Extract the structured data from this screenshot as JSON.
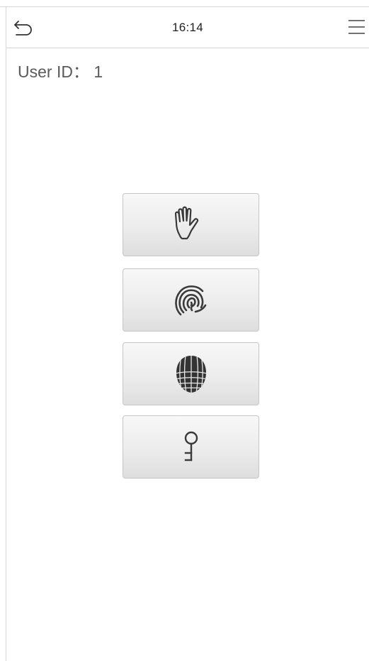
{
  "header": {
    "time": "16:14",
    "back_icon": "back-arrow-icon",
    "menu_icon": "hamburger-menu-icon"
  },
  "user": {
    "id_label": "User ID： 1"
  },
  "verify_options": [
    {
      "name": "palm",
      "icon": "palm-icon"
    },
    {
      "name": "fingerprint",
      "icon": "fingerprint-icon"
    },
    {
      "name": "face",
      "icon": "face-icon"
    },
    {
      "name": "password",
      "icon": "key-icon"
    }
  ]
}
